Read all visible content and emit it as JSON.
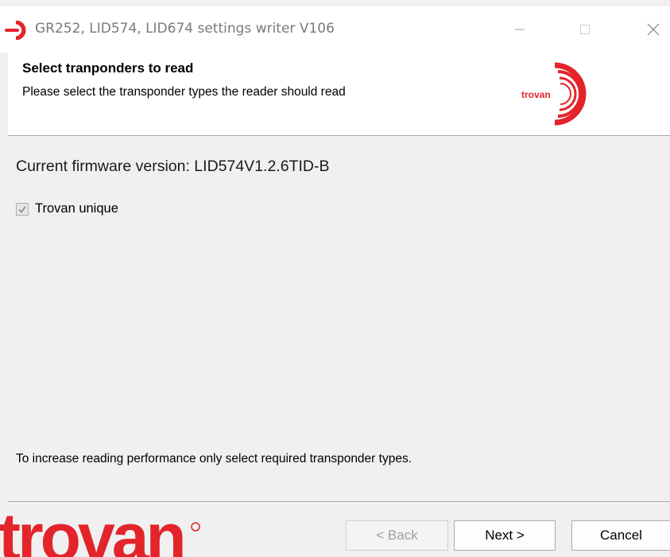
{
  "window": {
    "title": "GR252, LID574, LID674 settings writer V106",
    "controls": {
      "minimize_icon": "minimize-icon",
      "maximize_icon": "maximize-icon",
      "close_icon": "close-icon"
    }
  },
  "header": {
    "title": "Select tranponders to read",
    "subtitle": "Please select the transponder types the reader should read",
    "logo_text": "trovan"
  },
  "content": {
    "firmware_label": "Current firmware version: LID574V1.2.6TID-B",
    "transponder_options": [
      {
        "label": "Trovan unique",
        "checked": true,
        "enabled": false
      }
    ],
    "hint": "To increase reading performance only select required transponder types."
  },
  "footer": {
    "brand_text": "trovan",
    "back_label": "< Back",
    "next_label": "Next >",
    "cancel_label": "Cancel"
  },
  "colors": {
    "brand_red": "#e3242b",
    "dialog_bg": "#f0f0f0",
    "title_text": "#7a7a7a",
    "disabled_text": "#a0a0a0"
  }
}
